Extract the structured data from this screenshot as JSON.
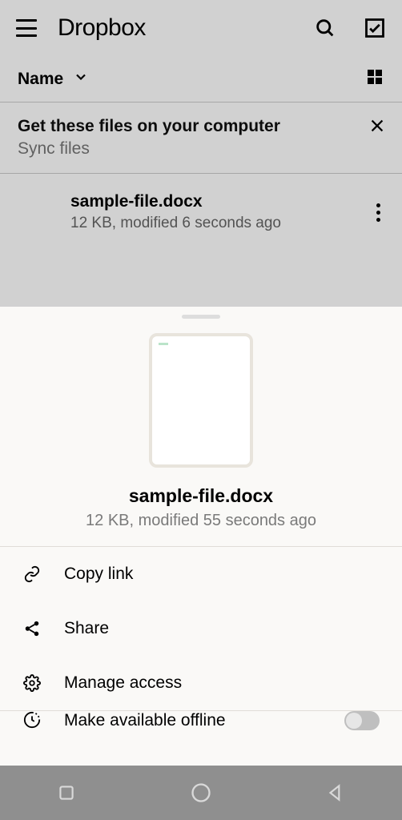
{
  "header": {
    "app_title": "Dropbox"
  },
  "sort": {
    "label": "Name"
  },
  "banner": {
    "title": "Get these files on your computer",
    "subtitle": "Sync files"
  },
  "file": {
    "name": "sample-file.docx",
    "meta": "12 KB, modified 6 seconds ago"
  },
  "sheet": {
    "title": "sample-file.docx",
    "meta": "12 KB, modified 55 seconds ago",
    "actions": {
      "copy_link": "Copy link",
      "share": "Share",
      "manage_access": "Manage access",
      "offline": "Make available offline"
    }
  }
}
